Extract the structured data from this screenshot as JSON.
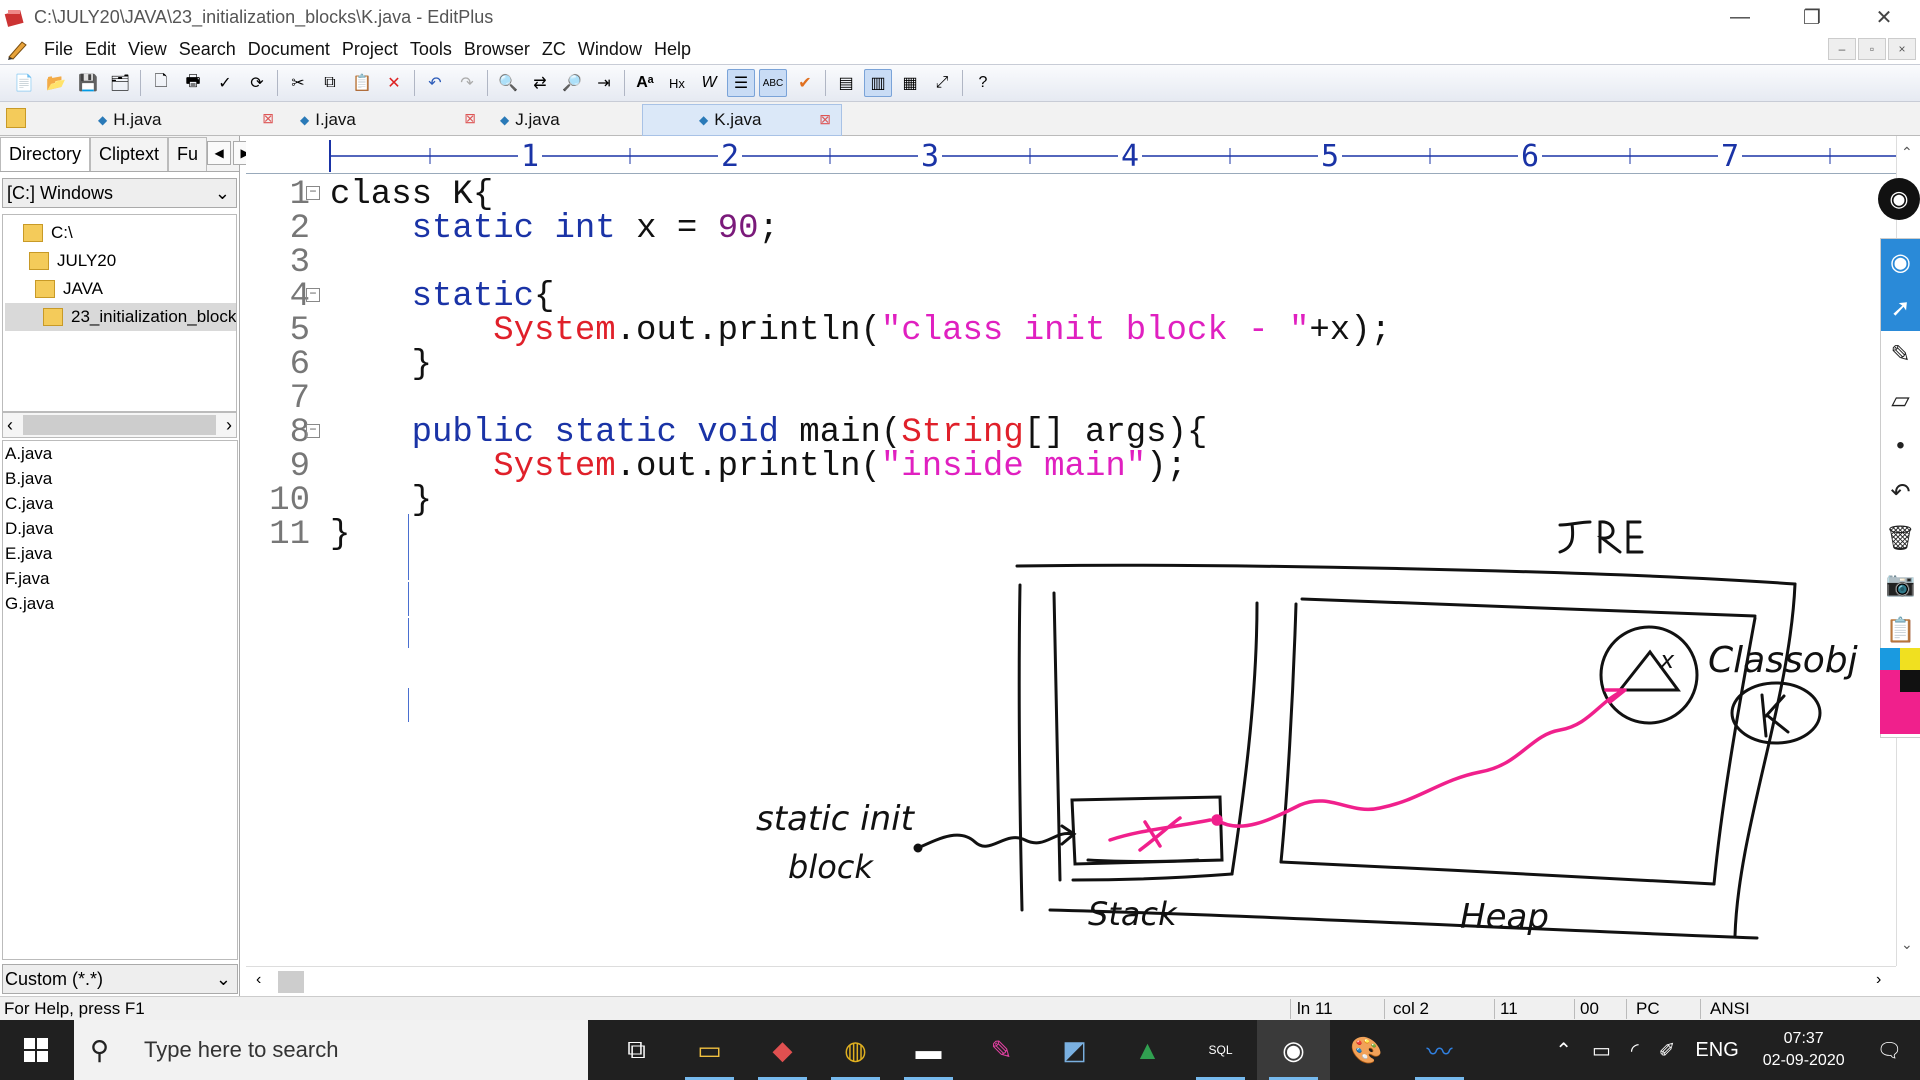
{
  "window": {
    "title": "C:\\JULY20\\JAVA\\23_initialization_blocks\\K.java - EditPlus",
    "controls": [
      "—",
      "❐",
      "✕"
    ]
  },
  "menu": [
    "File",
    "Edit",
    "View",
    "Search",
    "Document",
    "Project",
    "Tools",
    "Browser",
    "ZC",
    "Window",
    "Help"
  ],
  "tabs": [
    {
      "label": "H.java",
      "active": false
    },
    {
      "label": "I.java",
      "active": false
    },
    {
      "label": "J.java",
      "active": false
    },
    {
      "label": "K.java",
      "active": true
    }
  ],
  "left_panel": {
    "tabs": [
      "Directory",
      "Cliptext",
      "Fu"
    ],
    "drive": "[C:] Windows",
    "tree": [
      "C:\\",
      "JULY20",
      "JAVA",
      "23_initialization_block"
    ],
    "files": [
      "A.java",
      "B.java",
      "C.java",
      "D.java",
      "E.java",
      "F.java",
      "G.java"
    ],
    "filter": "Custom (*.*)"
  },
  "ruler": [
    "1",
    "2",
    "3",
    "4",
    "5",
    "6",
    "7"
  ],
  "code": {
    "line_numbers": [
      "1",
      "2",
      "3",
      "4",
      "5",
      "6",
      "7",
      "8",
      "9",
      "10",
      "11"
    ],
    "lines": [
      [
        {
          "t": "class K{",
          "c": "plain"
        }
      ],
      [
        {
          "t": "    ",
          "c": "plain"
        },
        {
          "t": "static",
          "c": "kw"
        },
        {
          "t": " ",
          "c": "plain"
        },
        {
          "t": "int",
          "c": "kw"
        },
        {
          "t": " x = ",
          "c": "plain"
        },
        {
          "t": "90",
          "c": "num"
        },
        {
          "t": ";",
          "c": "plain"
        }
      ],
      [],
      [
        {
          "t": "    ",
          "c": "plain"
        },
        {
          "t": "static",
          "c": "kw"
        },
        {
          "t": "{",
          "c": "plain"
        }
      ],
      [
        {
          "t": "        ",
          "c": "plain"
        },
        {
          "t": "System",
          "c": "cls"
        },
        {
          "t": ".out.println(",
          "c": "plain"
        },
        {
          "t": "\"class init block - \"",
          "c": "str"
        },
        {
          "t": "+x);",
          "c": "plain"
        }
      ],
      [
        {
          "t": "    }",
          "c": "plain"
        }
      ],
      [],
      [
        {
          "t": "    ",
          "c": "plain"
        },
        {
          "t": "public",
          "c": "kw"
        },
        {
          "t": " ",
          "c": "plain"
        },
        {
          "t": "static",
          "c": "kw"
        },
        {
          "t": " ",
          "c": "plain"
        },
        {
          "t": "void",
          "c": "kw"
        },
        {
          "t": " main(",
          "c": "plain"
        },
        {
          "t": "String",
          "c": "cls"
        },
        {
          "t": "[] args){",
          "c": "plain"
        }
      ],
      [
        {
          "t": "        ",
          "c": "plain"
        },
        {
          "t": "System",
          "c": "cls"
        },
        {
          "t": ".out.println(",
          "c": "plain"
        },
        {
          "t": "\"inside main\"",
          "c": "str"
        },
        {
          "t": ");",
          "c": "plain"
        }
      ],
      [
        {
          "t": "    }",
          "c": "plain"
        }
      ],
      [
        {
          "t": "}",
          "c": "plain"
        }
      ]
    ]
  },
  "annotations": {
    "jre": "JRE",
    "stack": "Stack",
    "heap": "Heap",
    "static_init_block": "static init block",
    "class_obj": "Classobj",
    "k_label": "K",
    "x_label": "x"
  },
  "status": {
    "help": "For Help, press F1",
    "ln": "ln 11",
    "col": "col 2",
    "lines": "11",
    "code": "00",
    "pc": "PC",
    "encoding": "ANSI"
  },
  "taskbar": {
    "search_placeholder": "Type here to search",
    "lang": "ENG",
    "time": "07:37",
    "date": "02-09-2020"
  },
  "colors": {
    "keyword": "#1a33a6",
    "class": "#e0202a",
    "string": "#e020c0",
    "number": "#7a1a7a",
    "ink_pink": "#f0208c"
  }
}
